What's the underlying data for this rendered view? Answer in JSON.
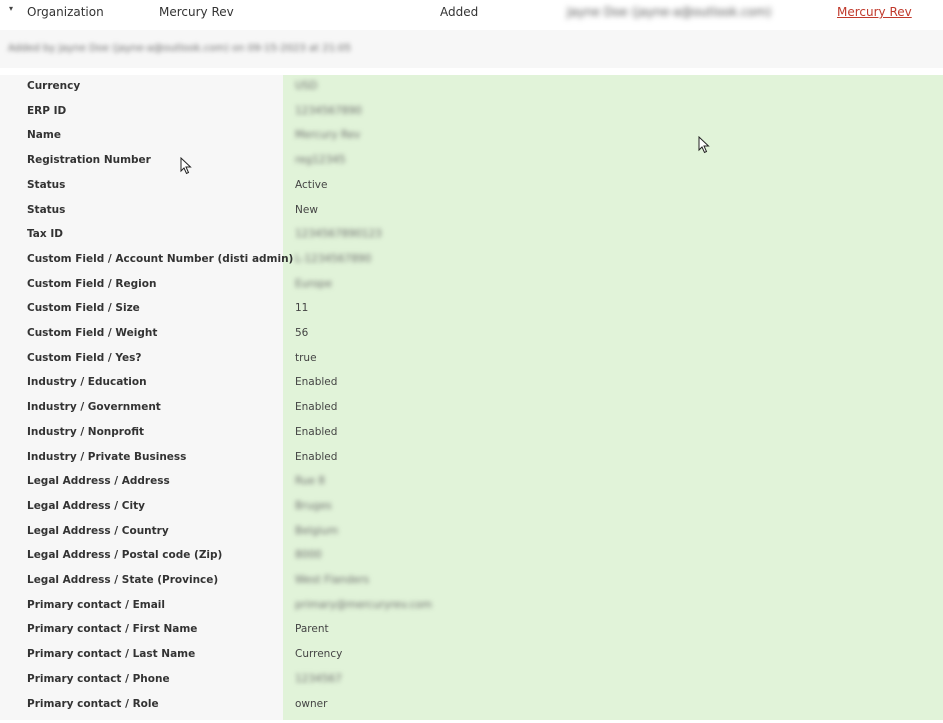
{
  "header": {
    "expand_glyph": "▾",
    "type": "Organization",
    "name": "Mercury Rev",
    "action": "Added",
    "user_email": "Jayne Doe (jayne-a@outlook.com)",
    "link": "Mercury Rev"
  },
  "subheader": {
    "text": "Added by Jayne Doe (jayne-a@outlook.com) on 09-15-2023 at 21:05"
  },
  "fields": [
    {
      "label": "Currency",
      "value": "USD",
      "obscured": true
    },
    {
      "label": "ERP ID",
      "value": "1234567890",
      "obscured": true
    },
    {
      "label": "Name",
      "value": "Mercury Rev",
      "obscured": true
    },
    {
      "label": "Registration Number",
      "value": "reg12345",
      "obscured": true
    },
    {
      "label": "Status",
      "value": "Active",
      "obscured": false
    },
    {
      "label": "Status",
      "value": "New",
      "obscured": false
    },
    {
      "label": "Tax ID",
      "value": "1234567890123",
      "obscured": true
    },
    {
      "label": "Custom Field / Account Number (disti admin)",
      "value": "L-1234567890",
      "obscured": true
    },
    {
      "label": "Custom Field / Region",
      "value": "Europe",
      "obscured": true
    },
    {
      "label": "Custom Field / Size",
      "value": "11",
      "obscured": false
    },
    {
      "label": "Custom Field / Weight",
      "value": "56",
      "obscured": false
    },
    {
      "label": "Custom Field / Yes?",
      "value": "true",
      "obscured": false
    },
    {
      "label": "Industry / Education",
      "value": "Enabled",
      "obscured": false
    },
    {
      "label": "Industry / Government",
      "value": "Enabled",
      "obscured": false
    },
    {
      "label": "Industry / Nonprofit",
      "value": "Enabled",
      "obscured": false
    },
    {
      "label": "Industry / Private Business",
      "value": "Enabled",
      "obscured": false
    },
    {
      "label": "Legal Address / Address",
      "value": "Rue 8",
      "obscured": true
    },
    {
      "label": "Legal Address / City",
      "value": "Bruges",
      "obscured": true
    },
    {
      "label": "Legal Address / Country",
      "value": "Belgium",
      "obscured": true
    },
    {
      "label": "Legal Address / Postal code (Zip)",
      "value": "8000",
      "obscured": true
    },
    {
      "label": "Legal Address / State (Province)",
      "value": "West Flanders",
      "obscured": true
    },
    {
      "label": "Primary contact / Email",
      "value": "primary@mercuryrev.com",
      "obscured": true
    },
    {
      "label": "Primary contact / First Name",
      "value": "Parent",
      "obscured": false
    },
    {
      "label": "Primary contact / Last Name",
      "value": "Currency",
      "obscured": false
    },
    {
      "label": "Primary contact / Phone",
      "value": "1234567",
      "obscured": true
    },
    {
      "label": "Primary contact / Role",
      "value": "owner",
      "obscured": false
    }
  ],
  "colors": {
    "label_bg": "#f7f7f7",
    "value_bg": "#e1f3d9",
    "link": "#c0392b"
  },
  "icons": [
    "chevron-down-icon",
    "mouse-pointer-icon"
  ]
}
